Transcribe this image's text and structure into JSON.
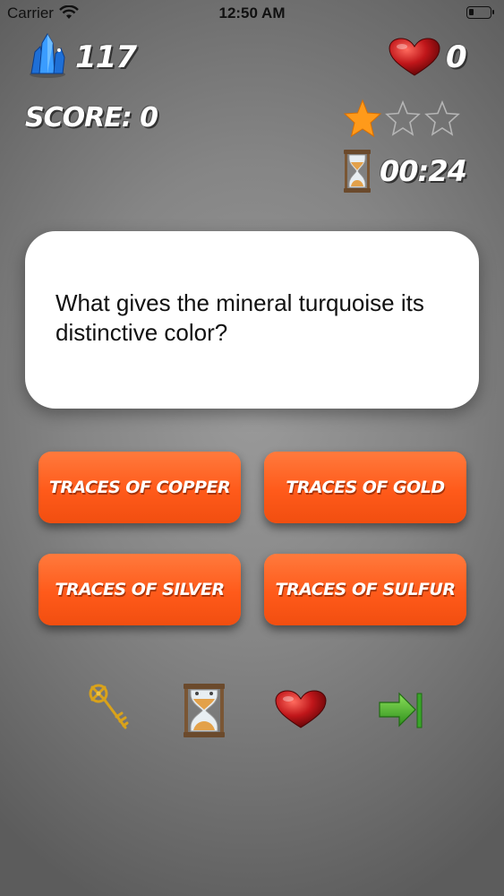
{
  "status_bar": {
    "carrier": "Carrier",
    "time": "12:50 AM"
  },
  "hud": {
    "gems": "117",
    "lives": "0",
    "score": "SCORE: 0",
    "stars_filled": 1,
    "stars_total": 3,
    "timer": "00:24"
  },
  "question": {
    "text": "What gives the mineral turquoise its distinctive color?"
  },
  "answers": [
    {
      "label": "Traces of Copper"
    },
    {
      "label": "Traces of Gold"
    },
    {
      "label": "Traces of Silver"
    },
    {
      "label": "Traces of Sulfur"
    }
  ],
  "lifelines": [
    {
      "icon": "key-icon"
    },
    {
      "icon": "hourglass-icon"
    },
    {
      "icon": "heart-icon"
    },
    {
      "icon": "skip-icon"
    }
  ],
  "colors": {
    "answer_button": "#ff5a1a",
    "star": "#ff9a1a",
    "heart": "#c0161a",
    "skip": "#4caf2a"
  }
}
